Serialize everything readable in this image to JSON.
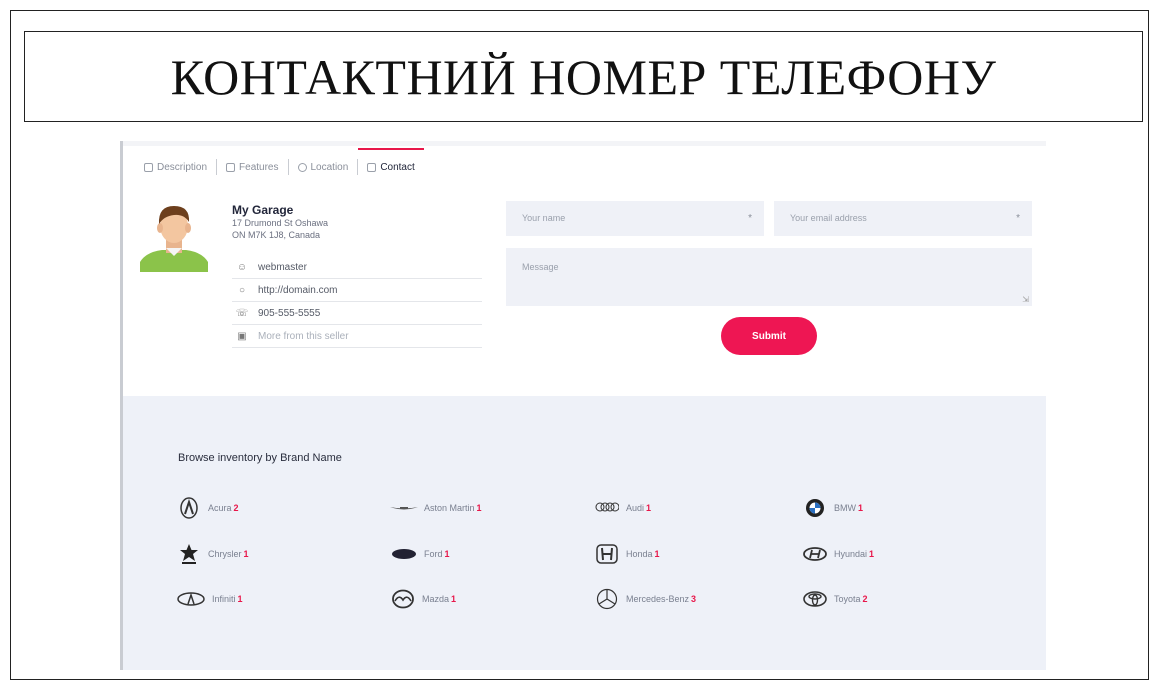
{
  "slide": {
    "title": "КОНТАКТНИЙ НОМЕР ТЕЛЕФОНУ"
  },
  "tabs": [
    {
      "label": "Description",
      "icon": "edit-icon",
      "active": false
    },
    {
      "label": "Features",
      "icon": "car-icon",
      "active": false
    },
    {
      "label": "Location",
      "icon": "map-pin-icon",
      "active": false
    },
    {
      "label": "Contact",
      "icon": "contact-card-icon",
      "active": true
    }
  ],
  "seller": {
    "name": "My Garage",
    "address_line1": "17 Drumond St Oshawa",
    "address_line2": "ON M7K 1J8, Canada",
    "rows": [
      {
        "icon": "user-icon",
        "text": "webmaster"
      },
      {
        "icon": "globe-icon",
        "text": "http://domain.com"
      },
      {
        "icon": "phone-icon",
        "text": "905-555-5555"
      },
      {
        "icon": "car-icon",
        "text": "More from this seller"
      }
    ]
  },
  "form": {
    "name_placeholder": "Your name",
    "email_placeholder": "Your email address",
    "message_placeholder": "Message",
    "required_mark": "*",
    "submit_label": "Submit"
  },
  "brands": {
    "heading": "Browse inventory by Brand Name",
    "items": [
      {
        "name": "Acura",
        "count": "2",
        "icon": "acura-logo-icon"
      },
      {
        "name": "Aston Martin",
        "count": "1",
        "icon": "aston-martin-logo-icon"
      },
      {
        "name": "Audi",
        "count": "1",
        "icon": "audi-logo-icon"
      },
      {
        "name": "BMW",
        "count": "1",
        "icon": "bmw-logo-icon"
      },
      {
        "name": "Chrysler",
        "count": "1",
        "icon": "chrysler-logo-icon"
      },
      {
        "name": "Ford",
        "count": "1",
        "icon": "ford-logo-icon"
      },
      {
        "name": "Honda",
        "count": "1",
        "icon": "honda-logo-icon"
      },
      {
        "name": "Hyundai",
        "count": "1",
        "icon": "hyundai-logo-icon"
      },
      {
        "name": "Infiniti",
        "count": "1",
        "icon": "infiniti-logo-icon"
      },
      {
        "name": "Mazda",
        "count": "1",
        "icon": "mazda-logo-icon"
      },
      {
        "name": "Mercedes-Benz",
        "count": "3",
        "icon": "mercedes-benz-logo-icon"
      },
      {
        "name": "Toyota",
        "count": "2",
        "icon": "toyota-logo-icon"
      }
    ]
  },
  "colors": {
    "accent": "#ee1653",
    "panel_bg": "#eef1f8",
    "input_bg": "#eff1f7"
  }
}
